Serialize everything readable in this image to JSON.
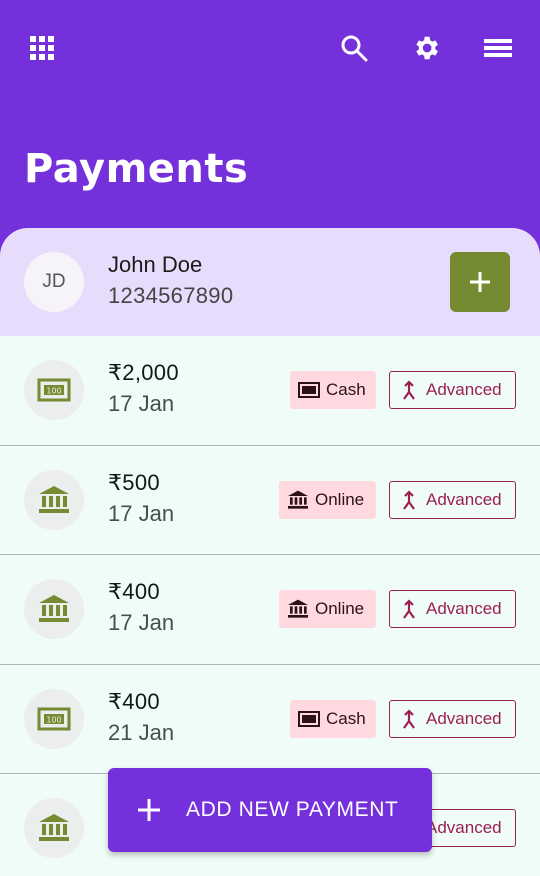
{
  "header": {
    "title": "Payments",
    "icons": [
      "apps-icon",
      "search-icon",
      "settings-icon",
      "menu-icon"
    ],
    "background": "#7330db"
  },
  "customer": {
    "initials": "JD",
    "name": "John Doe",
    "phone": "1234567890",
    "add_icon": "plus-icon",
    "add_color": "#758b31"
  },
  "payments": [
    {
      "amount": "₹2,000",
      "date": "17 Jan",
      "icon": "cash-icon",
      "mode": "Cash",
      "type": "Advanced"
    },
    {
      "amount": "₹500",
      "date": "17 Jan",
      "icon": "bank-icon",
      "mode": "Online",
      "type": "Advanced"
    },
    {
      "amount": "₹400",
      "date": "17 Jan",
      "icon": "bank-icon",
      "mode": "Online",
      "type": "Advanced"
    },
    {
      "amount": "₹400",
      "date": "21 Jan",
      "icon": "cash-icon",
      "mode": "Cash",
      "type": "Advanced"
    },
    {
      "amount": "",
      "date": "",
      "icon": "bank-icon",
      "mode": "",
      "type": "Advanced"
    }
  ],
  "fab": {
    "label": "ADD NEW PAYMENT",
    "icon": "plus-icon"
  }
}
